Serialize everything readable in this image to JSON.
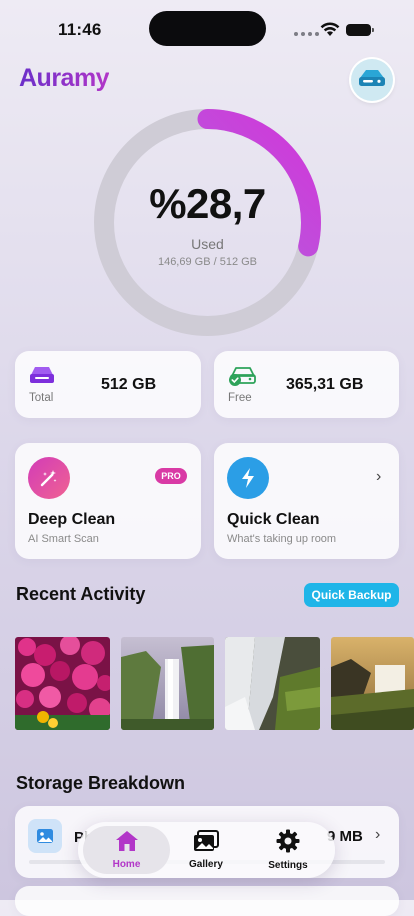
{
  "status_bar": {
    "time": "11:46"
  },
  "header": {
    "brand": "Auramy"
  },
  "usage": {
    "percent_label": "%28,7",
    "used_label": "Used",
    "detail": "146,69 GB / 512 GB",
    "fraction": 0.287
  },
  "stats": [
    {
      "label": "Total",
      "value": "512 GB",
      "icon": "drive-icon"
    },
    {
      "label": "Free",
      "value": "365,31 GB",
      "icon": "drive-check-icon"
    }
  ],
  "actions": [
    {
      "title": "Deep Clean",
      "subtitle": "AI Smart Scan",
      "badge": "PRO",
      "icon": "magic-wand-icon"
    },
    {
      "title": "Quick Clean",
      "subtitle": "What's taking up room",
      "icon": "lightning-icon"
    }
  ],
  "recent": {
    "title": "Recent Activity",
    "button": "Quick Backup"
  },
  "storage": {
    "title": "Storage Breakdown",
    "row_name": "Ph",
    "row_size": "9 MB"
  },
  "nav": {
    "items": [
      {
        "label": "Home"
      },
      {
        "label": "Gallery"
      },
      {
        "label": "Settings"
      }
    ]
  },
  "colors": {
    "brand_start": "#6b2fc9",
    "brand_end": "#b236c8",
    "accent_cyan": "#1fb5e8",
    "pro_pink": "#d93aa5",
    "nav_active": "#b236c8"
  }
}
